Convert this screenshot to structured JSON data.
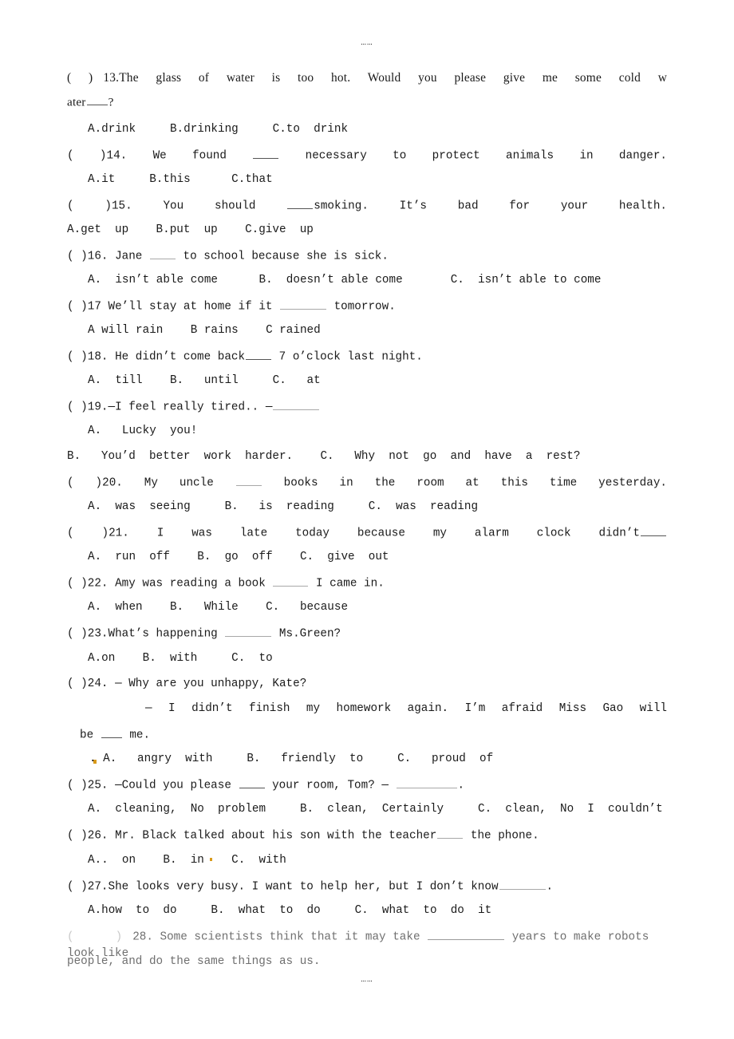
{
  "document": {
    "type": "english-multiple-choice-worksheet",
    "top_ellipsis": "……",
    "bottom_ellipsis": "……"
  },
  "questions": [
    {
      "number": "13",
      "marker": "(     )",
      "stem_line1": "13.The  glass  of  water  is  too  hot.  Would  you  please  give  me  some  cold  w",
      "stem_line2": "ater",
      "stem_line2_tail": "?",
      "choices": "A.drink     B.drinking     C.to  drink"
    },
    {
      "number": "14",
      "marker": "(      )",
      "stem_pre": "14.  We  found ",
      "stem_post": "  necessary  to  protect  animals  in  danger.",
      "choices": "A.it     B.this      C.that"
    },
    {
      "number": "15",
      "marker": "(   )",
      "stem_pre": "15.  You  should ",
      "stem_post": "smoking.  It’s  bad  for  your  health.",
      "choices": "A.get  up    B.put  up    C.give  up"
    },
    {
      "number": "16",
      "marker": "(   )",
      "stem_pre": "16.  Jane ",
      "stem_post": " to school because she is sick.",
      "choices": "A.  isn’t able come      B.  doesn’t able come       C.  isn’t able to come"
    },
    {
      "number": "17",
      "marker": "(  )",
      "stem_pre": "17 We’ll stay at home if it ",
      "stem_post": " tomorrow.",
      "choices": "A will rain    B rains    C rained"
    },
    {
      "number": "18",
      "marker": "(  )",
      "stem_pre": "18.  He  didn’t  come  back",
      "stem_post": "  7  o’clock  last  night.",
      "choices": "A.  till    B.   until     C.   at"
    },
    {
      "number": "19",
      "marker": "(   )",
      "stem_pre": "19.—I  feel  really  tired..   —",
      "stem_post": "",
      "choices_a": "A.   Lucky  you!",
      "choices_bc": "B.   You’d  better  work  harder.    C.   Why  not  go  and  have  a  rest?"
    },
    {
      "number": "20",
      "marker": "(   )",
      "stem_pre": "20.  My  uncle ",
      "stem_post": " books  in  the  room  at  this  time  yesterday.",
      "choices": "A.  was  seeing     B.   is  reading     C.  was  reading"
    },
    {
      "number": "21",
      "marker": "(   )",
      "stem_pre": "21.  I  was  late  today  because  my  alarm  clock  didn’t",
      "stem_post": "",
      "choices": "A.  run  off    B.  go  off    C.  give  out"
    },
    {
      "number": "22",
      "marker": "(   )",
      "stem_pre": "22.  Amy  was  reading  a  book ",
      "stem_post": " I  came  in.",
      "choices": "A.  when    B.   While    C.   because"
    },
    {
      "number": "23",
      "marker": "(   )",
      "stem_pre": "23.What’s  happening ",
      "stem_post": " Ms.Green?",
      "choices": "A.on    B.  with     C.  to"
    },
    {
      "number": "24",
      "marker": "(   )",
      "stem_line1": "24.   —  Why  are  you  unhappy,  Kate?",
      "stem_line2": "—  I  didn’t  finish  my  homework  again.  I’m  afraid  Miss  Gao  will",
      "stem_line3_pre": "be ",
      "stem_line3_post": " me.",
      "choices": ". A.   angry  with     B.   friendly  to     C.   proud  of"
    },
    {
      "number": "25",
      "marker": "(   )",
      "stem_pre": "25.  —Could  you  please ",
      "stem_mid": " your  room,  Tom?  — ",
      "stem_post": ".",
      "choices": "A.  cleaning,  No  problem     B.  clean,  Certainly     C.  clean,  No  I  couldn’t"
    },
    {
      "number": "26",
      "marker": "(   )",
      "stem_pre": "26.  Mr.  Black  talked  about  his  son  with  the  teacher",
      "stem_post": "  the  phone.",
      "choices": "A..  on    B.  in    C.  with"
    },
    {
      "number": "27",
      "marker": "(   )",
      "stem_pre": "27.She  looks  very  busy.  I  want  to  help  her,  but  I  don’t  know",
      "stem_post": ".",
      "choices": "A.how  to  do     B.  what  to  do     C.  what  to  do  it"
    },
    {
      "number": "28",
      "marker_open": "(",
      "marker_close": ")",
      "stem_line1_pre": "28. Some scientists think that it may take ",
      "stem_line1_post": " years to make robots look like",
      "stem_line2": "people, and do the same things as us."
    }
  ],
  "colors": {
    "text": "#1a1a1a",
    "faded_text": "#6f6f6f",
    "ghost": "#c9c9c9",
    "speck": "#d99a1a",
    "rule": "#555555",
    "background": "#ffffff"
  }
}
